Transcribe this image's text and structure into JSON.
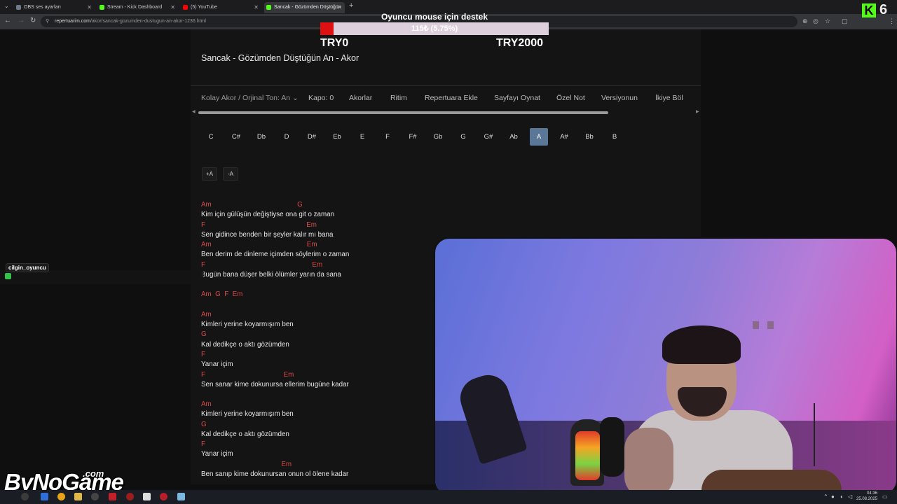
{
  "browser": {
    "tabs": [
      {
        "title": "OBS ses ayarları",
        "color": "#6c7a89"
      },
      {
        "title": "Stream - Kick Dashboard",
        "color": "#53fc18"
      },
      {
        "title": "(5) YouTube",
        "color": "#ff0000"
      },
      {
        "title": "Sancak - Gözümden Düştüğün",
        "color": "#53fc18"
      }
    ],
    "url_host": "repertuarim.com",
    "url_path": "/akor/sancak-gozumden-dustugun-an-akor-1236.html"
  },
  "donation": {
    "title": "Oyuncu mouse için destek",
    "progress_text": "115₺ (5.75%)",
    "progress_fraction": 0.0575,
    "min_label": "TRY0",
    "max_label": "TRY2000"
  },
  "kick": {
    "logo": "K",
    "viewer_count": "6"
  },
  "page": {
    "song_title": "Sancak - Gözümden Düştüğün An - Akor",
    "toolbar": [
      "Kolay Akor / Orjinal Ton: An",
      "Kapo: 0",
      "Akorlar",
      "Ritim",
      "Repertuara Ekle",
      "Sayfayı Oynat",
      "Özel Not",
      "Versiyonun",
      "İkiye Böl"
    ],
    "keys": [
      "C",
      "C#",
      "Db",
      "D",
      "D#",
      "Eb",
      "E",
      "F",
      "F#",
      "Gb",
      "G",
      "G#",
      "Ab",
      "A",
      "A#",
      "Bb",
      "B"
    ],
    "selected_key": "A",
    "size_up": "+A",
    "size_down": "-A",
    "lines": [
      {
        "type": "chord",
        "text": "Am                                             G"
      },
      {
        "type": "lyric",
        "text": "Kim için gülüşün değiştiyse ona git o zaman"
      },
      {
        "type": "chord",
        "text": "F                                                     Em"
      },
      {
        "type": "lyric",
        "text": "Sen gidince benden bir şeyler kalır mı bana"
      },
      {
        "type": "chord",
        "text": "Am                                                  Em"
      },
      {
        "type": "lyric",
        "text": "Ben derim de dinleme içimden söylerim o zaman"
      },
      {
        "type": "chord",
        "text": "F                                                        Em"
      },
      {
        "type": "lyric",
        "text": "Bugün bana düşer belki ölümler yarın da sana"
      },
      {
        "type": "chord",
        "text": "Am  G  F  Em"
      },
      {
        "type": "chord",
        "text": "Am"
      },
      {
        "type": "lyric",
        "text": "Kimleri yerine koyarmışım ben"
      },
      {
        "type": "chord",
        "text": "G"
      },
      {
        "type": "lyric",
        "text": "Kal dedikçe o aktı gözümden"
      },
      {
        "type": "chord",
        "text": "F"
      },
      {
        "type": "lyric",
        "text": "Yanar içim"
      },
      {
        "type": "chord",
        "text": "F                                         Em"
      },
      {
        "type": "lyric",
        "text": "Sen sanar kime dokunursa ellerim bugüne kadar"
      },
      {
        "type": "chord",
        "text": "Am"
      },
      {
        "type": "lyric",
        "text": "Kimleri yerine koyarmışım ben"
      },
      {
        "type": "chord",
        "text": "G"
      },
      {
        "type": "lyric",
        "text": "Kal dedikçe o aktı gözümden"
      },
      {
        "type": "chord",
        "text": "F"
      },
      {
        "type": "lyric",
        "text": "Yanar içim"
      },
      {
        "type": "chord",
        "text": "                                          Em"
      },
      {
        "type": "lyric",
        "text": "Ben sanıp kime dokunursan onun ol ölene kadar"
      }
    ]
  },
  "chat": {
    "username": "cilgin_oyuncu"
  },
  "watermark": {
    "text": "ByNoGame",
    "suffix": ".com"
  },
  "taskbar": {
    "clock_time": "04:36",
    "clock_date": "25.08.2025"
  },
  "colors": {
    "chord": "#d94a4a",
    "selected_key": "#5b7797",
    "kick": "#53fc18",
    "donation_fill": "#dd1111"
  }
}
